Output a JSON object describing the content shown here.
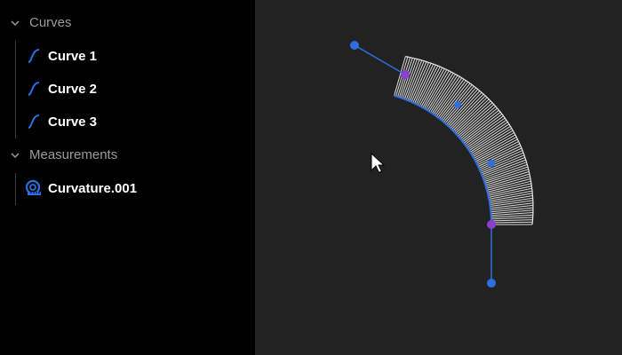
{
  "sidebar": {
    "groups": [
      {
        "label": "Curves",
        "items": [
          {
            "label": "Curve 1",
            "icon": "curve-icon"
          },
          {
            "label": "Curve 2",
            "icon": "curve-icon"
          },
          {
            "label": "Curve 3",
            "icon": "curve-icon"
          }
        ]
      },
      {
        "label": "Measurements",
        "items": [
          {
            "label": "Curvature.001",
            "icon": "measuring-tape-icon"
          }
        ]
      }
    ]
  },
  "colors": {
    "sidebar_bg": "#000000",
    "viewport_bg": "#222223",
    "accent_blue": "#2f6ee0",
    "control_point": "#2f6ee0",
    "endpoint_purple": "#8a3fd0",
    "comb_lines": "#d9d9d9",
    "group_label": "#9b9b9b",
    "item_label": "#ffffff"
  }
}
